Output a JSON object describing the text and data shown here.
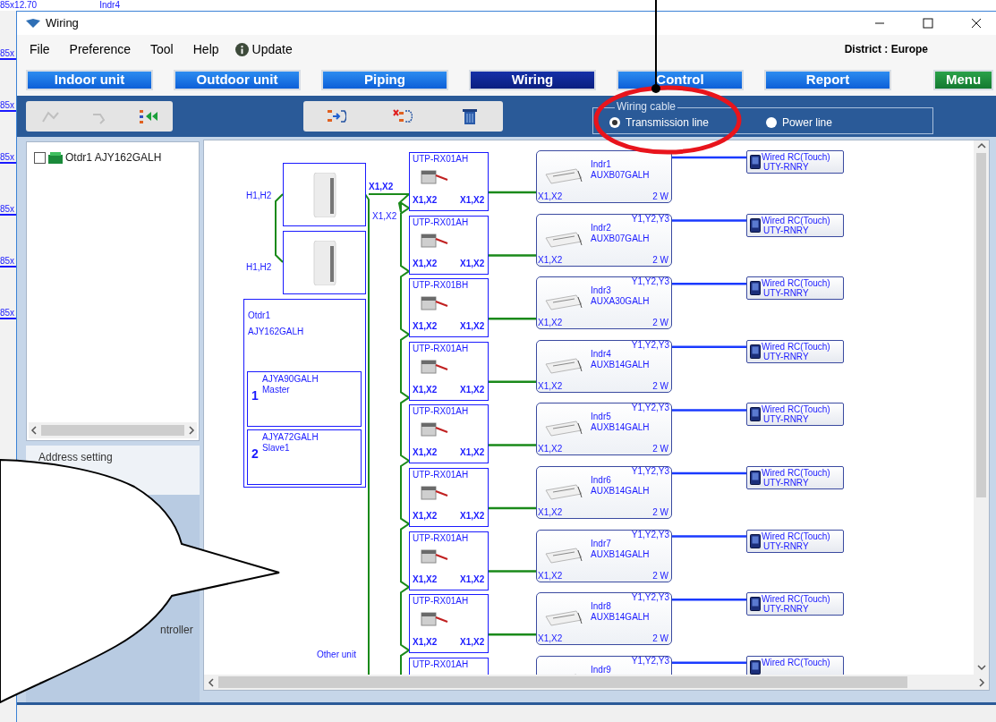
{
  "background_window": {
    "top_texts": [
      "85x12.70",
      "Indr4"
    ],
    "side_labels": [
      "85x",
      "85x",
      "85x",
      "85x",
      "85x",
      "85x"
    ]
  },
  "window": {
    "title": "Wiring"
  },
  "menu": [
    "File",
    "Preference",
    "Tool",
    "Help"
  ],
  "update": {
    "label": "Update"
  },
  "district": "District : Europe",
  "tabs": [
    {
      "label": "Indoor unit",
      "kind": "tab",
      "selected": false
    },
    {
      "label": "Outdoor unit",
      "kind": "tab",
      "selected": false
    },
    {
      "label": "Piping",
      "kind": "tab",
      "selected": false
    },
    {
      "label": "Wiring",
      "kind": "tab",
      "selected": true
    },
    {
      "label": "Control",
      "kind": "tab",
      "selected": false
    },
    {
      "label": "Report",
      "kind": "tab",
      "selected": false
    },
    {
      "label": "Menu",
      "kind": "menu",
      "selected": false
    }
  ],
  "toolbar_left": [
    {
      "kind": "link",
      "disabled": true
    },
    {
      "kind": "unlink",
      "disabled": true
    },
    {
      "kind": "connect",
      "disabled": false
    }
  ],
  "toolbar_right": [
    {
      "kind": "add-wire",
      "disabled": false
    },
    {
      "kind": "remove-wire",
      "disabled": false
    },
    {
      "kind": "delete",
      "disabled": false
    }
  ],
  "wiring_cable": {
    "title": "Wiring cable",
    "options": [
      {
        "label": "Transmission line",
        "selected": true
      },
      {
        "label": "Power line",
        "selected": false
      }
    ]
  },
  "tree": [
    {
      "label": "Otdr1 AJY162GALH",
      "checked": false
    }
  ],
  "address_setting": "Address setting",
  "lower_text": "ntroller",
  "diagram": {
    "outdoor": {
      "terminals": [
        "H1,H2",
        "H1,H2"
      ],
      "bus_labels": [
        "X1,X2",
        "X1,X2"
      ],
      "name": "Otdr1",
      "model": "AJY162GALH",
      "modules": [
        {
          "number": "1",
          "model": "AJYA90GALH",
          "role": "Master"
        },
        {
          "number": "2",
          "model": "AJYA72GALH",
          "role": "Slave1"
        }
      ],
      "other_unit": "Other unit"
    },
    "rows": [
      {
        "converter": "UTP-RX01AH",
        "conv_in": "X1,X2",
        "conv_out": "X1,X2",
        "name": "Indr1",
        "model": "AUXB07GALH",
        "terminal": "X1,X2",
        "power": "2 W",
        "remote_title": "Wired RC(Touch)",
        "remote_model": "UTY-RNRY"
      },
      {
        "converter": "UTP-RX01AH",
        "conv_in": "X1,X2",
        "conv_out": "X1,X2",
        "name": "Indr2",
        "model": "AUXB07GALH",
        "terminal": "X1,X2",
        "power": "2 W",
        "rc_terminal": "Y1,Y2,Y3",
        "remote_title": "Wired RC(Touch)",
        "remote_model": "UTY-RNRY"
      },
      {
        "converter": "UTP-RX01BH",
        "conv_in": "X1,X2",
        "conv_out": "X1,X2",
        "name": "Indr3",
        "model": "AUXA30GALH",
        "terminal": "X1,X2",
        "power": "2 W",
        "rc_terminal": "Y1,Y2,Y3",
        "remote_title": "Wired RC(Touch)",
        "remote_model": "UTY-RNRY"
      },
      {
        "converter": "UTP-RX01AH",
        "conv_in": "X1,X2",
        "conv_out": "X1,X2",
        "name": "Indr4",
        "model": "AUXB14GALH",
        "terminal": "X1,X2",
        "power": "2 W",
        "rc_terminal": "Y1,Y2,Y3",
        "remote_title": "Wired RC(Touch)",
        "remote_model": "UTY-RNRY"
      },
      {
        "converter": "UTP-RX01AH",
        "conv_in": "X1,X2",
        "conv_out": "X1,X2",
        "name": "Indr5",
        "model": "AUXB14GALH",
        "terminal": "X1,X2",
        "power": "2 W",
        "rc_terminal": "Y1,Y2,Y3",
        "remote_title": "Wired RC(Touch)",
        "remote_model": "UTY-RNRY"
      },
      {
        "converter": "UTP-RX01AH",
        "conv_in": "X1,X2",
        "conv_out": "X1,X2",
        "name": "Indr6",
        "model": "AUXB14GALH",
        "terminal": "X1,X2",
        "power": "2 W",
        "rc_terminal": "Y1,Y2,Y3",
        "remote_title": "Wired RC(Touch)",
        "remote_model": "UTY-RNRY"
      },
      {
        "converter": "UTP-RX01AH",
        "conv_in": "X1,X2",
        "conv_out": "X1,X2",
        "name": "Indr7",
        "model": "AUXB14GALH",
        "terminal": "X1,X2",
        "power": "2 W",
        "rc_terminal": "Y1,Y2,Y3",
        "remote_title": "Wired RC(Touch)",
        "remote_model": "UTY-RNRY"
      },
      {
        "converter": "UTP-RX01AH",
        "conv_in": "X1,X2",
        "conv_out": "X1,X2",
        "name": "Indr8",
        "model": "AUXB14GALH",
        "terminal": "X1,X2",
        "power": "2 W",
        "rc_terminal": "Y1,Y2,Y3",
        "remote_title": "Wired RC(Touch)",
        "remote_model": "UTY-RNRY"
      },
      {
        "converter": "UTP-RX01AH",
        "name": "Indr9",
        "rc_terminal": "Y1,Y2,Y3",
        "remote_title": "Wired RC(Touch)"
      }
    ]
  },
  "annotations": [
    {
      "kind": "callout"
    },
    {
      "kind": "ellipse"
    },
    {
      "kind": "pointer"
    }
  ]
}
